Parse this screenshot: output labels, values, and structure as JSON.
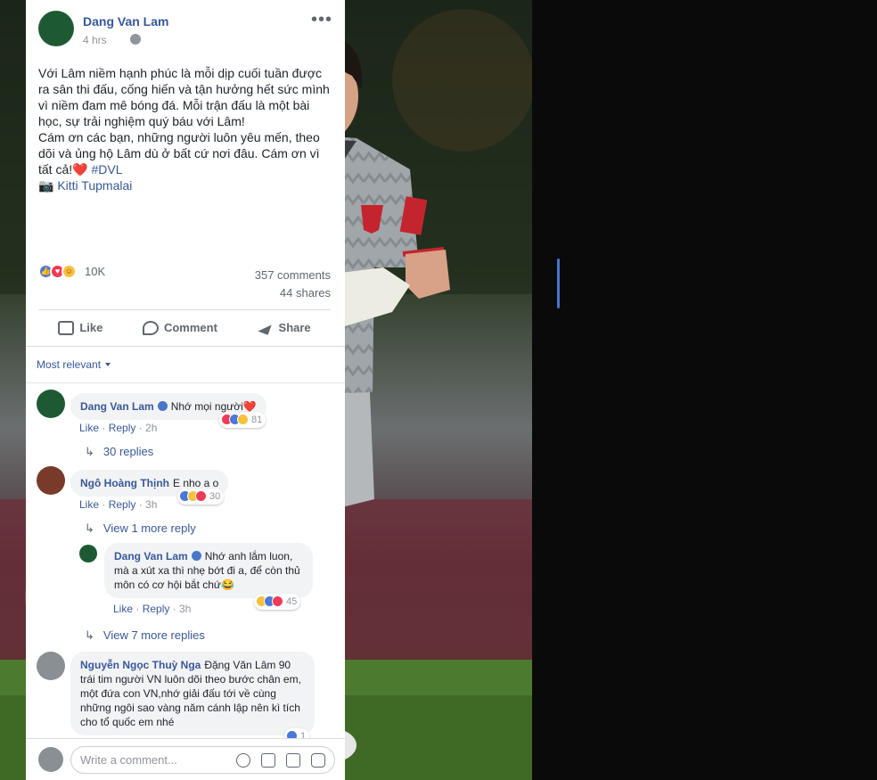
{
  "post": {
    "author": "Dang Van Lam",
    "time": "4 hrs",
    "more": "•••",
    "text_lines": [
      "Với Lâm niềm hạnh phúc là mỗi dịp cuối tuần được ra sân thi đấu, cống hiến và tận hưởng hết sức mình vì niềm đam mê bóng đá. Mỗi trận đấu là một bài học, sự trải nghiệm quý báu với Lâm!",
      "Cám ơn các bạn, những người luôn yêu mến, theo dõi và ủng hộ Lâm dù ở bất cứ nơi đâu. Cám ơn vì tất cả!❤️ ",
      "#DVL",
      "📷 ",
      "Kitti Tupmalai"
    ],
    "reactions_count": "10K",
    "comments_count": "357 comments",
    "shares_count": "44 shares"
  },
  "actions": {
    "like": "Like",
    "comment": "Comment",
    "share": "Share"
  },
  "comments": {
    "sort_label": "Most relevant",
    "items": [
      {
        "author": "Dang Van Lam",
        "text": "Nhớ mọi người❤️",
        "like": "Like",
        "reply": "Reply",
        "time": "2h",
        "reactions": "81",
        "replies_link": "30 replies"
      },
      {
        "author": "Ngô Hoàng Thịnh",
        "text": "E nho a o",
        "like": "Like",
        "reply": "Reply",
        "time": "3h",
        "reactions": "30",
        "replies_link": "View 1 more reply"
      },
      {
        "author": "Dang Van Lam",
        "text": "Nhớ anh lắm luon, mà a xút xa thì nhẹ bớt đi a, để còn thủ môn có cơ hội bắt chứ😂",
        "like": "Like",
        "reply": "Reply",
        "time": "3h",
        "reactions": "45",
        "replies_link": "View 7 more replies"
      },
      {
        "author": "Nguyễn Ngọc Thuỳ Nga",
        "text": "Đặng Văn Lâm 90 trái tim người VN luôn dõi theo bước chân em, một đứa con VN,nhớ giải đấu tới về cùng những ngôi sao vàng năm cánh lập nên kì tích cho tổ quốc em nhé",
        "reactions": "1"
      }
    ]
  },
  "composer": {
    "placeholder": "Write a comment..."
  },
  "colors": {
    "link": "#365899",
    "like_blue": "#4a78d8",
    "love_red": "#ef3b56",
    "haha_yellow": "#f7c13d",
    "kit_gray": "#9ea3a8",
    "pitch_green": "#3f6a26"
  }
}
